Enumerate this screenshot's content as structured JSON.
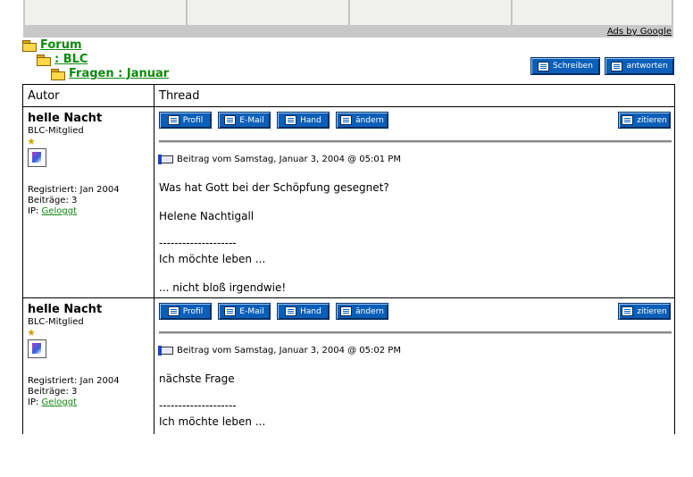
{
  "ads": {
    "label": "Ads by Google"
  },
  "breadcrumb": [
    {
      "label": "Forum"
    },
    {
      "label": ": BLC"
    },
    {
      "label": "Fragen : Januar"
    }
  ],
  "top_buttons": {
    "schreiben": "Schreiben",
    "antworten": "antworten"
  },
  "table": {
    "col_author": "Autor",
    "col_thread": "Thread"
  },
  "post_buttons": {
    "profil": "Profil",
    "email": "E-Mail",
    "hand": "Hand",
    "aendern": "ändern",
    "zitieren": "zitieren"
  },
  "posts": [
    {
      "author": "helle Nacht",
      "rank": "BLC-Mitglied",
      "registered": "Registriert: Jan 2004",
      "posts_count": "Beiträge: 3",
      "ip_label": "IP:",
      "ip_link": "Geloggt",
      "posted": "Beitrag vom Samstag, Januar 3, 2004 @ 05:01 PM",
      "lines": [
        "Was hat Gott bei der Schöpfung gesegnet?",
        "Helene Nachtigall",
        "--------------------",
        "Ich möchte leben ...",
        "... nicht bloß irgendwie!"
      ]
    },
    {
      "author": "helle Nacht",
      "rank": "BLC-Mitglied",
      "registered": "Registriert: Jan 2004",
      "posts_count": "Beiträge: 3",
      "ip_label": "IP:",
      "ip_link": "Geloggt",
      "posted": "Beitrag vom Samstag, Januar 3, 2004 @ 05:02 PM",
      "lines": [
        "nächste Frage",
        "--------------------",
        "Ich möchte leben ..."
      ]
    }
  ]
}
